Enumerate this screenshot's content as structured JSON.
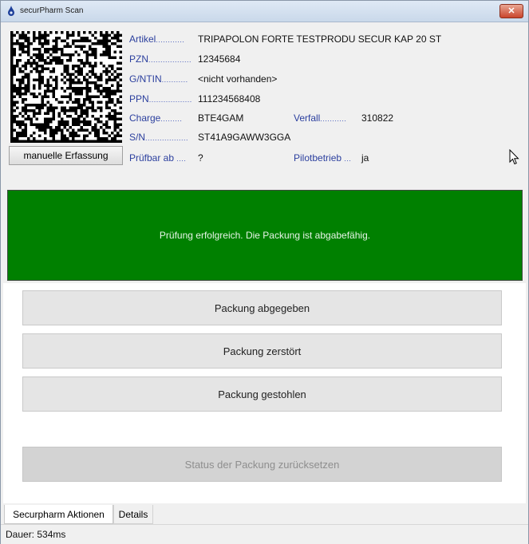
{
  "window": {
    "title": "securPharm Scan",
    "close_glyph": "✕"
  },
  "product": {
    "artikel": {
      "label": "Artikel",
      "dots": "............",
      "value": "TRIPAPOLON FORTE TESTPRODU SECUR KAP 20 ST"
    },
    "pzn": {
      "label": "PZN",
      "dots": "..................",
      "value": "12345684"
    },
    "gtin": {
      "label": "G/NTIN",
      "dots": "...........",
      "value": "<nicht vorhanden>"
    },
    "ppn": {
      "label": "PPN",
      "dots": "..................",
      "value": "111234568408"
    },
    "charge": {
      "label": "Charge",
      "dots": ".........",
      "value": "BTE4GAM"
    },
    "verfall": {
      "label": "Verfall",
      "dots": "...........",
      "value": "310822"
    },
    "sn": {
      "label": "S/N",
      "dots": "..................",
      "value": "ST41A9GAWW3GGA"
    },
    "pruefbar": {
      "label": "Prüfbar ab",
      "dots": "....",
      "value": "?"
    },
    "pilot": {
      "label": "Pilotbetrieb",
      "dots": "...",
      "value": "ja"
    }
  },
  "manual_button": {
    "label": "manuelle Erfassung"
  },
  "status": {
    "message": "Prüfung erfolgreich. Die Packung ist abgabefähig.",
    "color": "#008000"
  },
  "actions": {
    "dispensed": "Packung abgegeben",
    "destroyed": "Packung zerstört",
    "stolen": "Packung gestohlen",
    "reset": "Status der Packung zurücksetzen"
  },
  "tabs": [
    {
      "label": "Securpharm Aktionen",
      "active": true
    },
    {
      "label": "Details",
      "active": false
    }
  ],
  "statusbar": {
    "text": "Dauer: 534ms"
  },
  "icons": {
    "app": "app-icon",
    "barcode": "datamatrix-code",
    "cursor": "mouse-cursor-icon",
    "close": "close-icon"
  }
}
